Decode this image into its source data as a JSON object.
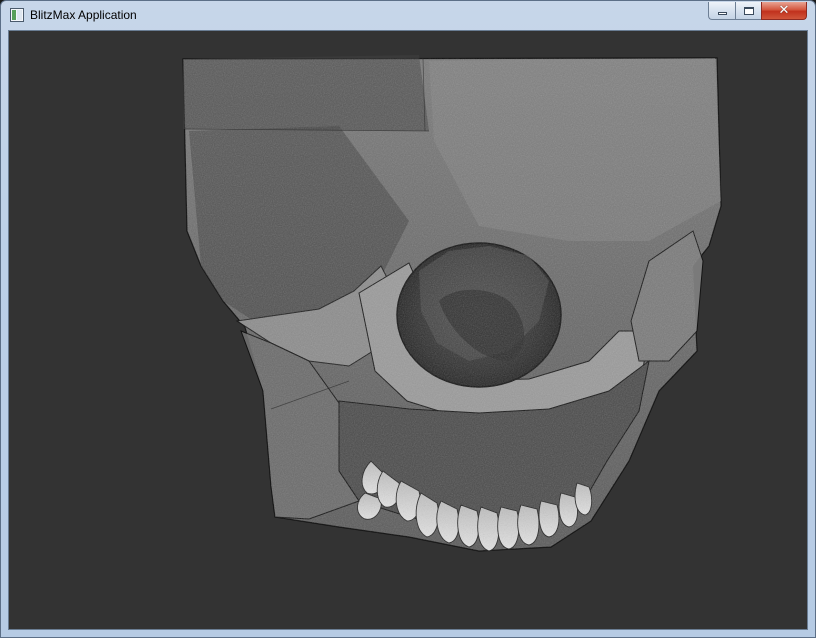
{
  "window": {
    "title": "BlitzMax Application",
    "icon": "blitzmax-app-icon",
    "controls": {
      "minimize": "minimize-icon",
      "maximize": "maximize-icon",
      "close": "close-icon",
      "close_glyph": "✕"
    }
  },
  "viewport": {
    "background_color": "#333333",
    "content": "volume-rendered-skull"
  },
  "colors": {
    "titlebar": "#bcd0e8",
    "close_button": "#c7432c",
    "canvas": "#333333"
  }
}
